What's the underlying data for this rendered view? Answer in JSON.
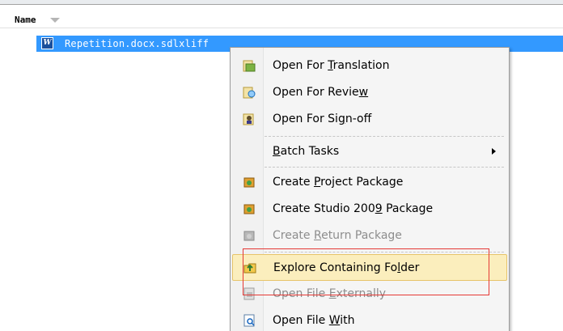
{
  "header": {
    "column_name": "Name",
    "sort_icon": "sort-down-icon"
  },
  "file": {
    "name": "Repetition.docx.sdlxliff",
    "icon": "word-document-icon",
    "icon_letter": "W",
    "selected_color": "#3399ff"
  },
  "context_menu": {
    "items": [
      {
        "label": "Open For Translation",
        "icon": "open-translation-icon",
        "enabled": true
      },
      {
        "label": "Open For Review",
        "icon": "open-review-icon",
        "enabled": true
      },
      {
        "label": "Open For Sign-off",
        "icon": "open-signoff-icon",
        "enabled": true
      },
      {
        "label": "Batch Tasks",
        "icon": "",
        "enabled": true,
        "submenu": true
      },
      {
        "label": "Create Project Package",
        "icon": "project-package-icon",
        "enabled": true
      },
      {
        "label": "Create Studio 2009 Package",
        "icon": "studio-package-icon",
        "enabled": true
      },
      {
        "label": "Create Return Package",
        "icon": "return-package-icon",
        "enabled": false
      },
      {
        "label": "Explore Containing Folder",
        "icon": "explore-folder-icon",
        "enabled": true,
        "hovered": true
      },
      {
        "label": "Open File Externally",
        "icon": "open-external-icon",
        "enabled": false
      },
      {
        "label": "Open File With",
        "icon": "open-with-icon",
        "enabled": true
      }
    ],
    "hover_color": "#fbeebd",
    "highlight_box_color": "#e53935"
  }
}
